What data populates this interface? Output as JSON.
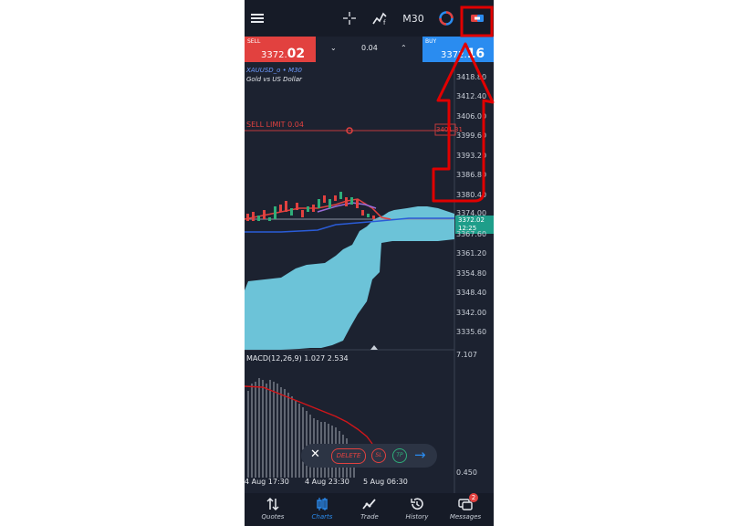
{
  "topbar": {
    "icons": [
      "menu-icon",
      "crosshair-icon",
      "indicators-icon",
      "timeframe",
      "objects-icon",
      "trade-toggle-icon"
    ],
    "timeframe": "M30"
  },
  "quote": {
    "sell_label": "SELL",
    "sell_main": "3372.",
    "sell_big": "02",
    "buy_label": "BUY",
    "buy_main": "3372.",
    "buy_big": "16",
    "lot": "0.04"
  },
  "chart": {
    "symbol": "XAUUSD_o • M30",
    "description": "Gold vs US Dollar",
    "sell_limit_label": "SELL LIMIT 0.04",
    "sell_limit_price": "3401.31",
    "current_price": "3372.02",
    "countdown": "12:25",
    "price_levels": [
      "3418.80",
      "3412.40",
      "3406.00",
      "3399.60",
      "3393.20",
      "3386.80",
      "3380.40",
      "3374.00",
      "3367.60",
      "3361.20",
      "3354.80",
      "3348.40",
      "3342.00",
      "3335.60"
    ],
    "macd_label": "MACD(12,26,9) 1.027 2.534",
    "macd_top": "7.107",
    "macd_bottom": "0.450",
    "time_labels": [
      "4 Aug 17:30",
      "4 Aug 23:30",
      "5 Aug 06:30"
    ]
  },
  "order_toolbar": {
    "close": "✕",
    "delete": "DELETE",
    "sl": "SL",
    "tp": "TP",
    "go": "→"
  },
  "bottom_nav": {
    "items": [
      {
        "label": "Quotes"
      },
      {
        "label": "Charts"
      },
      {
        "label": "Trade"
      },
      {
        "label": "History"
      },
      {
        "label": "Messages"
      }
    ],
    "messages_badge": "2",
    "active_color": "#2a8cf0"
  },
  "colors": {
    "background": "#1c2230",
    "sell": "#e2413f",
    "buy": "#2a8cf0",
    "cloud": "#6cc3d8",
    "annotation": "#e00000"
  }
}
